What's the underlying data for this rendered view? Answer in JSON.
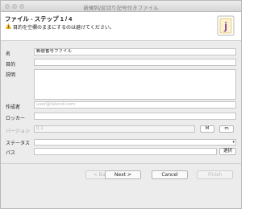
{
  "window": {
    "title": "新規列/区切り記号付きファイル"
  },
  "header": {
    "title": "ファイル - ステップ 1 / 4",
    "warning": "目的を空欄のままにするのは避けてください。",
    "icon": "file-delimited-icon"
  },
  "form": {
    "name": {
      "label": "名",
      "value": "郵便番号ファイル"
    },
    "purpose": {
      "label": "目的",
      "value": ""
    },
    "description": {
      "label": "説明",
      "value": ""
    },
    "author": {
      "label": "作成者",
      "placeholder": "user@talend.com"
    },
    "locker": {
      "label": "ロッカー",
      "value": ""
    },
    "version": {
      "label": "バージョン",
      "value": "0.1",
      "major_label": "M",
      "minor_label": "m"
    },
    "status": {
      "label": "ステータス",
      "value": ""
    },
    "path": {
      "label": "パス",
      "value": "",
      "browse_label": "選択"
    }
  },
  "buttons": {
    "back": "< Back",
    "next": "Next >",
    "cancel": "Cancel",
    "finish": "Finish"
  },
  "colors": {
    "warning": "#f2b705",
    "banner_accent": "#d9a300"
  }
}
